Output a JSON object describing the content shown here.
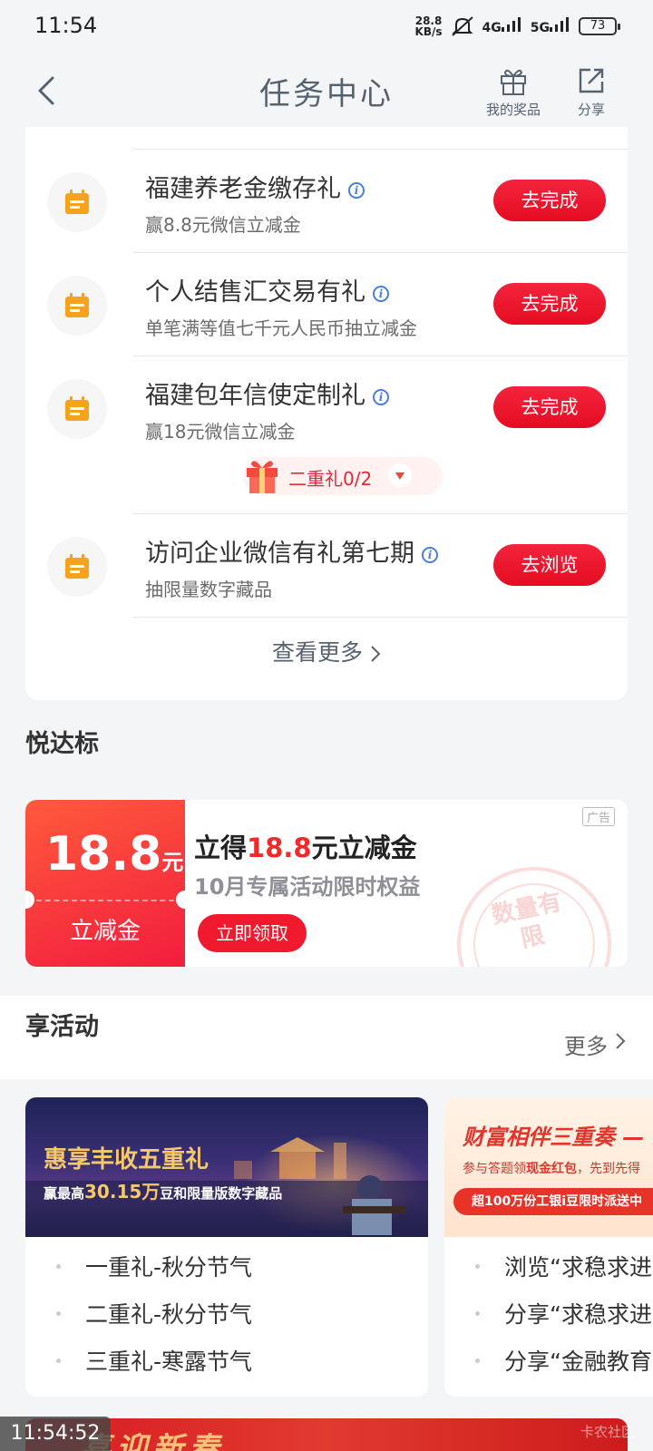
{
  "status_bar": {
    "time": "11:54",
    "net_speed_value": "28.8",
    "net_speed_unit": "KB/s",
    "signal1": "4G",
    "signal2": "5G",
    "battery": "73"
  },
  "header": {
    "title": "任务中心",
    "my_prizes": "我的奖品",
    "share": "分享"
  },
  "tasks": [
    {
      "name": "福建养老金缴存礼",
      "desc": "赢8.8元微信立减金",
      "button": "去完成"
    },
    {
      "name": "个人结售汇交易有礼",
      "desc": "单笔满等值七千元人民币抽立减金",
      "button": "去完成"
    },
    {
      "name": "福建包年信使定制礼",
      "desc": "赢18元微信立减金",
      "button": "去完成"
    },
    {
      "name": "访问企业微信有礼第七期",
      "desc": "抽限量数字藏品",
      "button": "去浏览"
    }
  ],
  "second_gift": "二重礼0/2",
  "see_more": "查看更多",
  "yuedabiao": {
    "title": "悦达标",
    "ad_tag": "广告",
    "coupon_amount": "18.8",
    "coupon_unit": "元",
    "coupon_label": "立减金",
    "headline_prefix": "立得",
    "headline_amount": "18.8",
    "headline_suffix": "元立减金",
    "subline": "10月专属活动限时权益",
    "button": "立即领取",
    "stamp_text": "数量有限"
  },
  "activities": {
    "title": "享活动",
    "more": "更多",
    "cards": [
      {
        "banner_title": "惠享丰收五重礼",
        "banner_sub_prefix": "赢最高",
        "banner_sub_amount": "30.15万",
        "banner_sub_suffix": "豆和限量版数字藏品",
        "items": [
          "一重礼-秋分节气",
          "二重礼-秋分节气",
          "三重礼-寒露节气"
        ]
      },
      {
        "banner_title": "财富相伴三重奏 — 二",
        "banner_sub_prefix": "参与答题领",
        "banner_sub_highlight": "现金红包",
        "banner_sub_suffix": "，先到先得",
        "banner_strip": "超100万份工银i豆限时派送中",
        "items": [
          "浏览“求稳求进",
          "分享“求稳求进",
          "分享“金融教育"
        ]
      }
    ]
  },
  "bottom": {
    "banner_text": "喜迎新春",
    "overlay_time": "11:54:52",
    "watermark": "卡农社区"
  }
}
